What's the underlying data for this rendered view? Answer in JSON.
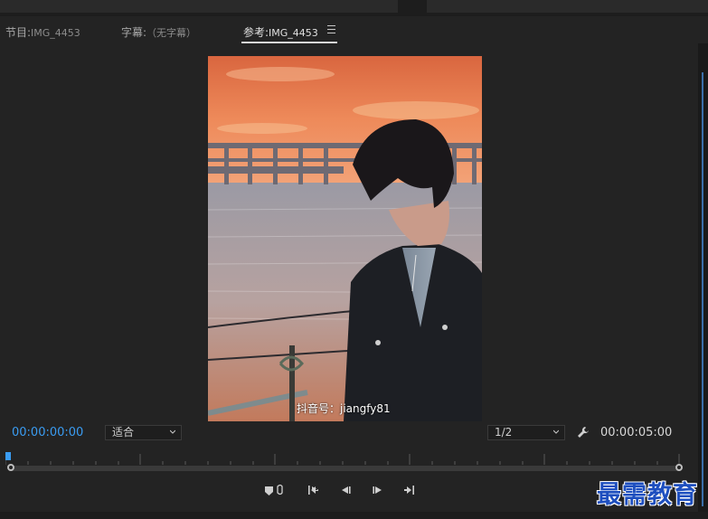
{
  "tabs": [
    {
      "label": "节目:",
      "value": "IMG_4453",
      "active": false
    },
    {
      "label": "字幕:",
      "value": "（无字幕）",
      "active": false
    },
    {
      "label": "参考:",
      "value": "IMG_4453",
      "active": true
    }
  ],
  "video": {
    "watermark": "抖音号：jiangfy81"
  },
  "controls_bar": {
    "current_timecode": "00:00:00:00",
    "fit_select": "适合",
    "resolution_select": "1/2",
    "duration_timecode": "00:00:05:00"
  },
  "transport": {
    "buttons": [
      "add-marker",
      "go-to-in",
      "step-back",
      "step-forward",
      "go-to-out"
    ]
  },
  "colors": {
    "accent": "#3a9cf2",
    "panel_bg": "#232323",
    "logo": "#1e4fbf"
  },
  "logo": {
    "text": "最需教育"
  }
}
